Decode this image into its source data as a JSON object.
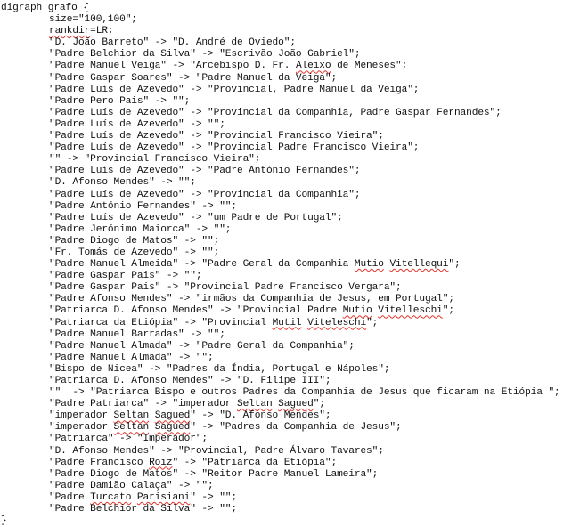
{
  "document": {
    "opening": "digraph grafo {",
    "closing": "}",
    "lines": [
      [
        {
          "t": "size=\"100,100\";"
        }
      ],
      [
        {
          "t": "rankdir",
          "s": true
        },
        {
          "t": "=LR;"
        }
      ],
      [
        {
          "t": "\"D. João Barreto\" -> \"D. André de Oviedo\";"
        }
      ],
      [
        {
          "t": "\"Padre Belchior da Silva\" -> \"Escrivão João Gabriel\";"
        }
      ],
      [
        {
          "t": "\"Padre Manuel Veiga\" -> \"Arcebispo D. Fr. "
        },
        {
          "t": "Aleixo",
          "s": true
        },
        {
          "t": " de Meneses\";"
        }
      ],
      [
        {
          "t": "\"Padre Gaspar Soares\" -> \"Padre Manuel da Veiga\";"
        }
      ],
      [
        {
          "t": "\"Padre Luís de Azevedo\" -> \"Provincial, Padre Manuel da Veiga\";"
        }
      ],
      [
        {
          "t": "\"Padre Pero Pais\" -> \"\";"
        }
      ],
      [
        {
          "t": "\"Padre Luís de Azevedo\" -> \"Provincial da Companhia, Padre Gaspar Fernandes\";"
        }
      ],
      [
        {
          "t": "\"Padre Luís de Azevedo\" -> \"\";"
        }
      ],
      [
        {
          "t": "\"Padre Luís de Azevedo\" -> \"Provincial Francisco Vieira\";"
        }
      ],
      [
        {
          "t": "\"Padre Luís de Azevedo\" -> \"Provincial Padre Francisco Vieira\";"
        }
      ],
      [
        {
          "t": "\"\" -> \"Provincial Francisco Vieira\";"
        }
      ],
      [
        {
          "t": "\"Padre Luís de Azevedo\" -> \"Padre António Fernandes\";"
        }
      ],
      [
        {
          "t": "\"D. Afonso Mendes\" -> \"\";"
        }
      ],
      [
        {
          "t": "\"Padre Luís de Azevedo\" -> \"Provincial da Companhia\";"
        }
      ],
      [
        {
          "t": "\"Padre António Fernandes\" -> \"\";"
        }
      ],
      [
        {
          "t": "\"Padre Luís de Azevedo\" -> \"um Padre de Portugal\";"
        }
      ],
      [
        {
          "t": "\"Padre Jerónimo Maiorca\" -> \"\";"
        }
      ],
      [
        {
          "t": "\"Padre Diogo de Matos\" -> \"\";"
        }
      ],
      [
        {
          "t": "\"Fr. Tomás de Azevedo\" -> \"\";"
        }
      ],
      [
        {
          "t": "\"Padre Manuel Almeida\" -> \"Padre Geral da Companhia "
        },
        {
          "t": "Mutio",
          "s": true
        },
        {
          "t": " "
        },
        {
          "t": "Vitellequi",
          "s": true
        },
        {
          "t": "\";"
        }
      ],
      [
        {
          "t": "\"Padre Gaspar Pais\" -> \"\";"
        }
      ],
      [
        {
          "t": "\"Padre Gaspar Pais\" -> \"Provincial Padre Francisco Vergara\";"
        }
      ],
      [
        {
          "t": "\"Padre Afonso Mendes\" -> \"irmãos da Companhia de Jesus, em Portugal\";"
        }
      ],
      [
        {
          "t": "\"Patriarca D. Afonso Mendes\" -> \"Provincial Padre "
        },
        {
          "t": "Mutio",
          "s": true
        },
        {
          "t": " "
        },
        {
          "t": "Vitelleschi",
          "s": true
        },
        {
          "t": "\";"
        }
      ],
      [
        {
          "t": "\"Patriarca da Etiópia\" -> \"Provincial "
        },
        {
          "t": "Mutil",
          "s": true
        },
        {
          "t": " "
        },
        {
          "t": "Viteleschi",
          "s": true
        },
        {
          "t": "\";"
        }
      ],
      [
        {
          "t": "\"Padre Manuel Barradas\" -> \"\";"
        }
      ],
      [
        {
          "t": "\"Padre Manuel Almada\" -> \"Padre Geral da Companhia\";"
        }
      ],
      [
        {
          "t": "\"Padre Manuel Almada\" -> \"\";"
        }
      ],
      [
        {
          "t": "\"Bispo de Nicea\" -> \"Padres da Índia, Portugal e Nápoles\";"
        }
      ],
      [
        {
          "t": "\"Patriarca D. Afonso Mendes\" -> \"D. Filipe III\";"
        }
      ],
      [
        {
          "t": "\"\"  -> \"Patriarca Bispo e outros Padres da Companhia de Jesus que ficaram na Etiópia \";"
        }
      ],
      [
        {
          "t": "\"Padre Patriarca\" -> \"imperador "
        },
        {
          "t": "Seltan",
          "s": true
        },
        {
          "t": " "
        },
        {
          "t": "Sagued",
          "s": true
        },
        {
          "t": "\";"
        }
      ],
      [
        {
          "t": "\"imperador "
        },
        {
          "t": "Seltan",
          "s": true
        },
        {
          "t": " "
        },
        {
          "t": "Sagued",
          "s": true
        },
        {
          "t": "\" -> \"D. Afonso Mendes\";"
        }
      ],
      [
        {
          "t": "\"imperador "
        },
        {
          "t": "Seltan",
          "s": true
        },
        {
          "t": " "
        },
        {
          "t": "Sagued",
          "s": true
        },
        {
          "t": "\" -> \"Padres da Companhia de Jesus\";"
        }
      ],
      [
        {
          "t": "\"Patriarca\" -> \"Imperador\";"
        }
      ],
      [
        {
          "t": "\"D. Afonso Mendes\" -> \"Provincial, Padre Álvaro Tavares\";"
        }
      ],
      [
        {
          "t": "\"Padre Francisco "
        },
        {
          "t": "Roiz",
          "s": true
        },
        {
          "t": "\" -> \"Patriarca da Etiópia\";"
        }
      ],
      [
        {
          "t": "\"Padre Diogo de Matos\" -> \"Reitor Padre Manuel Lameira\";"
        }
      ],
      [
        {
          "t": "\"Padre Damião Calaça\" -> \"\";"
        }
      ],
      [
        {
          "t": "\"Padre "
        },
        {
          "t": "Turcato",
          "s": true
        },
        {
          "t": " "
        },
        {
          "t": "Parisiani",
          "s": true
        },
        {
          "t": "\" -> \"\";"
        }
      ],
      [
        {
          "t": "\"Padre Belchior da Silva\" -> \"\";"
        }
      ]
    ]
  }
}
